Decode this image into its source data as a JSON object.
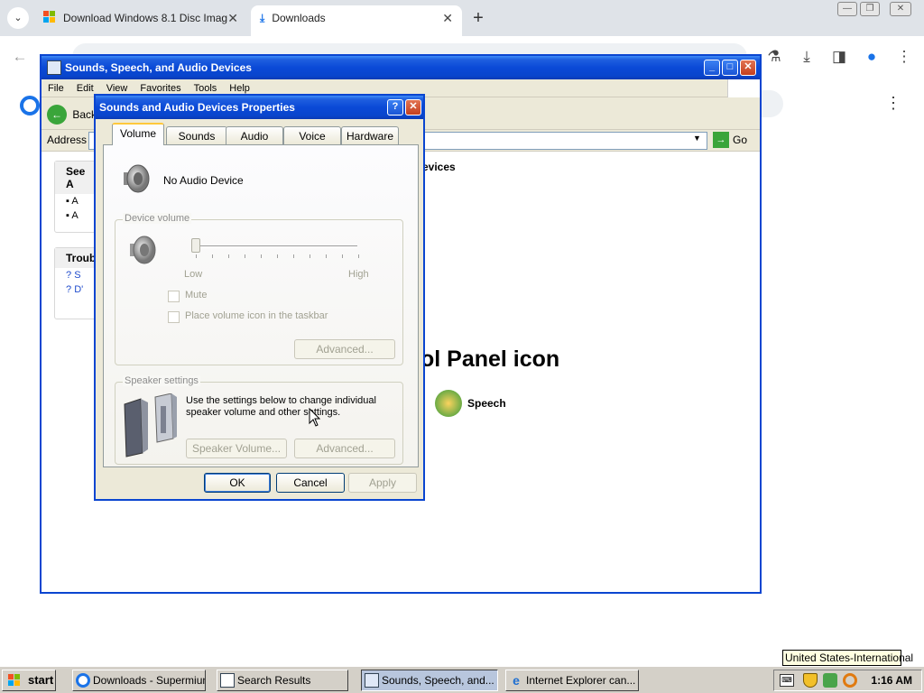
{
  "browser": {
    "tabs": [
      {
        "label": "Download Windows 8.1 Disc Imag",
        "active": false
      },
      {
        "label": "Downloads",
        "active": true
      }
    ],
    "new_tab": "+",
    "tab_search": "⌄",
    "toolbar_icons": [
      "back-icon",
      "labs-icon",
      "download-icon",
      "side-panel-icon",
      "profile-icon",
      "menu-icon"
    ],
    "page_menu": "⋮"
  },
  "cp_window": {
    "title": "Sounds, Speech, and Audio Devices",
    "menu": [
      "File",
      "Edit",
      "View",
      "Favorites",
      "Tools",
      "Help"
    ],
    "back_label": "Back",
    "address_label": "Address",
    "go_label": "Go",
    "see_also": "See A",
    "see_also_items": [
      "A",
      "A"
    ],
    "troubleshoot": "Troub",
    "troubleshoot_items": [
      "S",
      "D'"
    ],
    "category_heading_fragment": "evices",
    "pick_icon_fragment": "ol Panel icon",
    "speech_label": "Speech"
  },
  "dialog": {
    "title": "Sounds and Audio Devices Properties",
    "help_button": "?",
    "close_button": "✕",
    "tabs": [
      "Volume",
      "Sounds",
      "Audio",
      "Voice",
      "Hardware"
    ],
    "active_tab": "Volume",
    "device_name": "No Audio Device",
    "device_volume": {
      "caption": "Device volume",
      "low": "Low",
      "high": "High",
      "level": 0,
      "mute": "Mute",
      "taskbar_icon": "Place volume icon in the taskbar",
      "advanced": "Advanced..."
    },
    "speaker_settings": {
      "caption": "Speaker settings",
      "text": "Use the settings below to change individual speaker volume and other settings.",
      "speaker_volume": "Speaker Volume...",
      "advanced": "Advanced..."
    },
    "buttons": {
      "ok": "OK",
      "cancel": "Cancel",
      "apply": "Apply"
    }
  },
  "taskbar": {
    "start": "start",
    "tasks": [
      {
        "label": "Downloads - Supermium",
        "active": false
      },
      {
        "label": "Search Results",
        "active": false
      },
      {
        "label": "Sounds, Speech, and...",
        "active": true
      },
      {
        "label": "Internet Explorer can...",
        "active": false
      }
    ],
    "clock": "1:16 AM",
    "tooltip": "United States-International"
  }
}
